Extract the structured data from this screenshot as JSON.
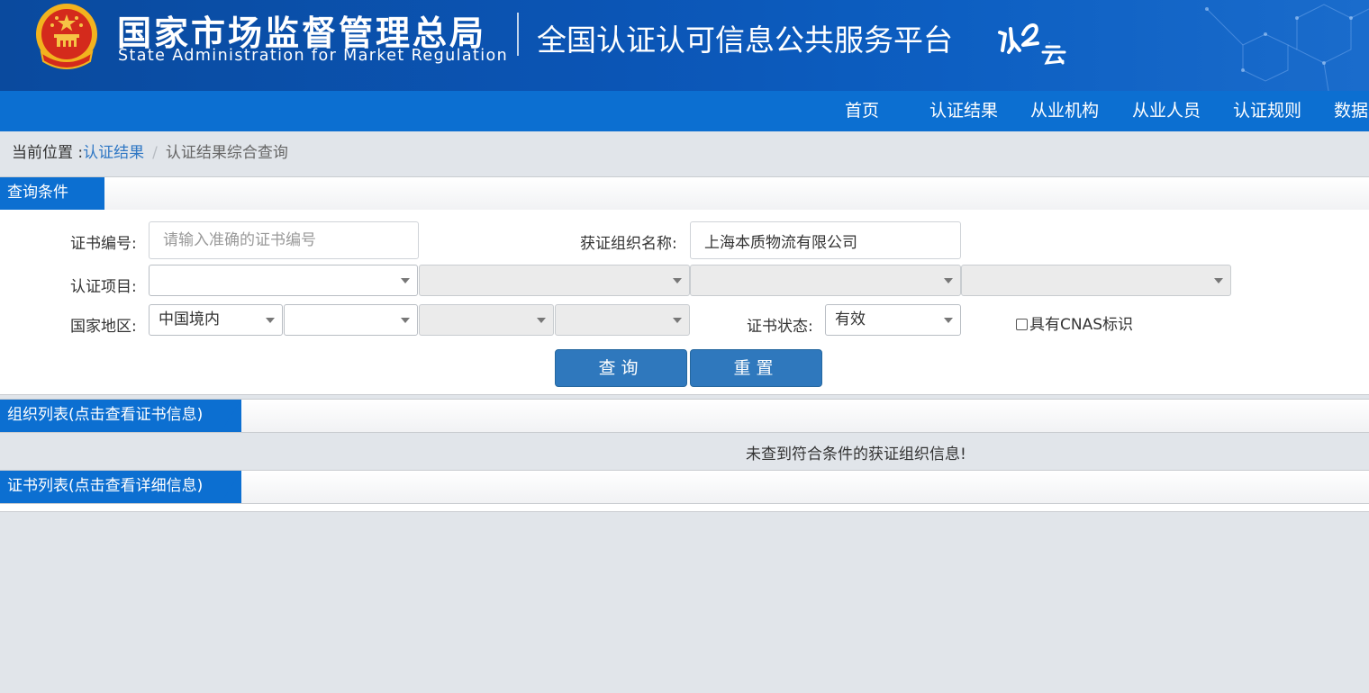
{
  "header": {
    "org_cn": "国家市场监督管理总局",
    "org_en": "State Administration  for  Market Regulation",
    "platform_title": "全国认证认可信息公共服务平台",
    "logo_text": "认云"
  },
  "nav": {
    "items": [
      "首页",
      "认证结果",
      "从业机构",
      "从业人员",
      "认证规则",
      "数据"
    ]
  },
  "breadcrumb": {
    "prefix": "当前位置 :",
    "link": "认证结果",
    "separator": "/",
    "current": "认证结果综合查询"
  },
  "query_panel": {
    "title": "查询条件",
    "cert_no_label": "证书编号:",
    "cert_no_placeholder": "请输入准确的证书编号",
    "org_name_label": "获证组织名称:",
    "org_name_value": "上海本质物流有限公司",
    "cert_item_label": "认证项目:",
    "region_label": "国家地区:",
    "region_value": "中国境内",
    "status_label": "证书状态:",
    "status_value": "有效",
    "cnas_label": "具有CNAS标识",
    "search_button": "查询",
    "reset_button": "重置"
  },
  "org_list": {
    "title": "组织列表(点击查看证书信息)",
    "empty_message": "未查到符合条件的获证组织信息!"
  },
  "cert_list": {
    "title": "证书列表(点击查看详细信息)"
  },
  "colors": {
    "header_blue": "#0b55b5",
    "nav_blue": "#0c6fd1",
    "button_blue": "#2f78bd",
    "link_blue": "#2f77c4",
    "page_bg": "#e1e5ea"
  }
}
